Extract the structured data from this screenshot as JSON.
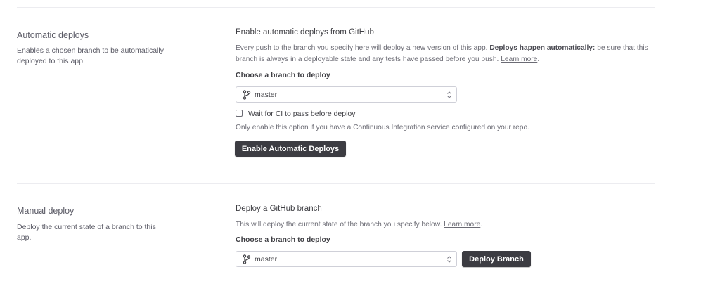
{
  "auto": {
    "title": "Automatic deploys",
    "description": "Enables a chosen branch to be automatically deployed to this app.",
    "heading": "Enable automatic deploys from GitHub",
    "para_lead": "Every push to the branch you specify here will deploy a new version of this app.",
    "para_bold": "Deploys happen automatically:",
    "para_tail": "be sure that this branch is always in a deployable state and any tests have passed before you push.",
    "learn_more": "Learn more",
    "choose_label": "Choose a branch to deploy",
    "branch_value": "master",
    "checkbox_label": "Wait for CI to pass before deploy",
    "checkbox_checked": false,
    "ci_hint": "Only enable this option if you have a Continuous Integration service configured on your repo.",
    "button_label": "Enable Automatic Deploys"
  },
  "manual": {
    "title": "Manual deploy",
    "description": "Deploy the current state of a branch to this app.",
    "heading": "Deploy a GitHub branch",
    "para_lead": "This will deploy the current state of the branch you specify below.",
    "learn_more": "Learn more",
    "choose_label": "Choose a branch to deploy",
    "branch_value": "master",
    "button_label": "Deploy Branch"
  },
  "colors": {
    "button_bg": "#3c3c42",
    "divider": "#ececf0",
    "text_muted": "#6b6b74"
  }
}
